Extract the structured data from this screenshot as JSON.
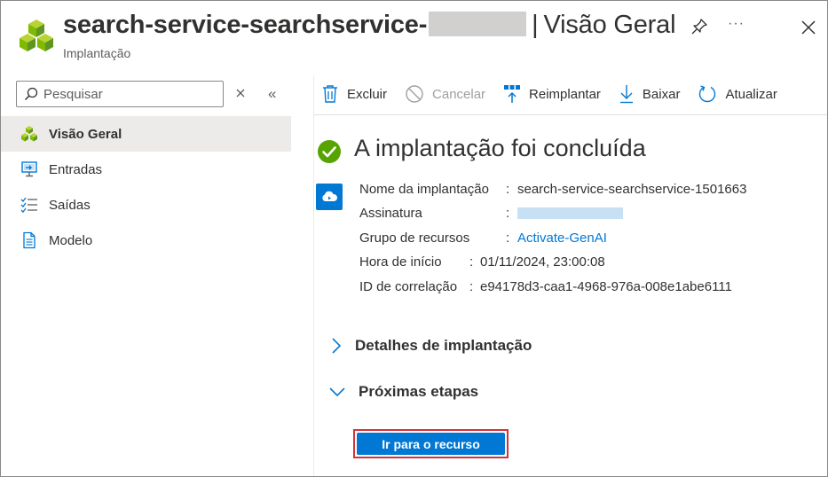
{
  "header": {
    "title_main": "search-service-searchservice-",
    "title_separator": "|",
    "title_view": "Visão Geral",
    "subtitle": "Implantação",
    "more_label": "···"
  },
  "sidebar": {
    "search_placeholder": "Pesquisar",
    "collapse_label": "«",
    "items": [
      {
        "label": "Visão Geral",
        "icon": "cubes-icon",
        "active": true
      },
      {
        "label": "Entradas",
        "icon": "monitor-input-icon",
        "active": false
      },
      {
        "label": "Saídas",
        "icon": "list-check-icon",
        "active": false
      },
      {
        "label": "Modelo",
        "icon": "document-icon",
        "active": false
      }
    ]
  },
  "toolbar": {
    "delete_label": "Excluir",
    "cancel_label": "Cancelar",
    "redeploy_label": "Reimplantar",
    "download_label": "Baixar",
    "refresh_label": "Atualizar"
  },
  "main": {
    "status_title": "A implantação foi concluída",
    "details": {
      "deployment_name_label": "Nome da implantação",
      "deployment_name_value": "search-service-searchservice-1501663",
      "subscription_label": "Assinatura",
      "resource_group_label": "Grupo de recursos",
      "resource_group_value": "Activate-GenAI",
      "start_time_label": "Hora de início",
      "start_time_value": "01/11/2024, 23:00:08",
      "correlation_label": "ID de correlação",
      "correlation_value": "e94178d3-caa1-4968-976a-008e1abe6111",
      "colon": ":"
    },
    "deployment_details_label": "Detalhes de implantação",
    "next_steps_label": "Próximas etapas",
    "go_to_resource_label": "Ir para o recurso"
  },
  "colors": {
    "accent": "#0078d4",
    "success": "#57a300",
    "highlight_border": "#d13438"
  }
}
